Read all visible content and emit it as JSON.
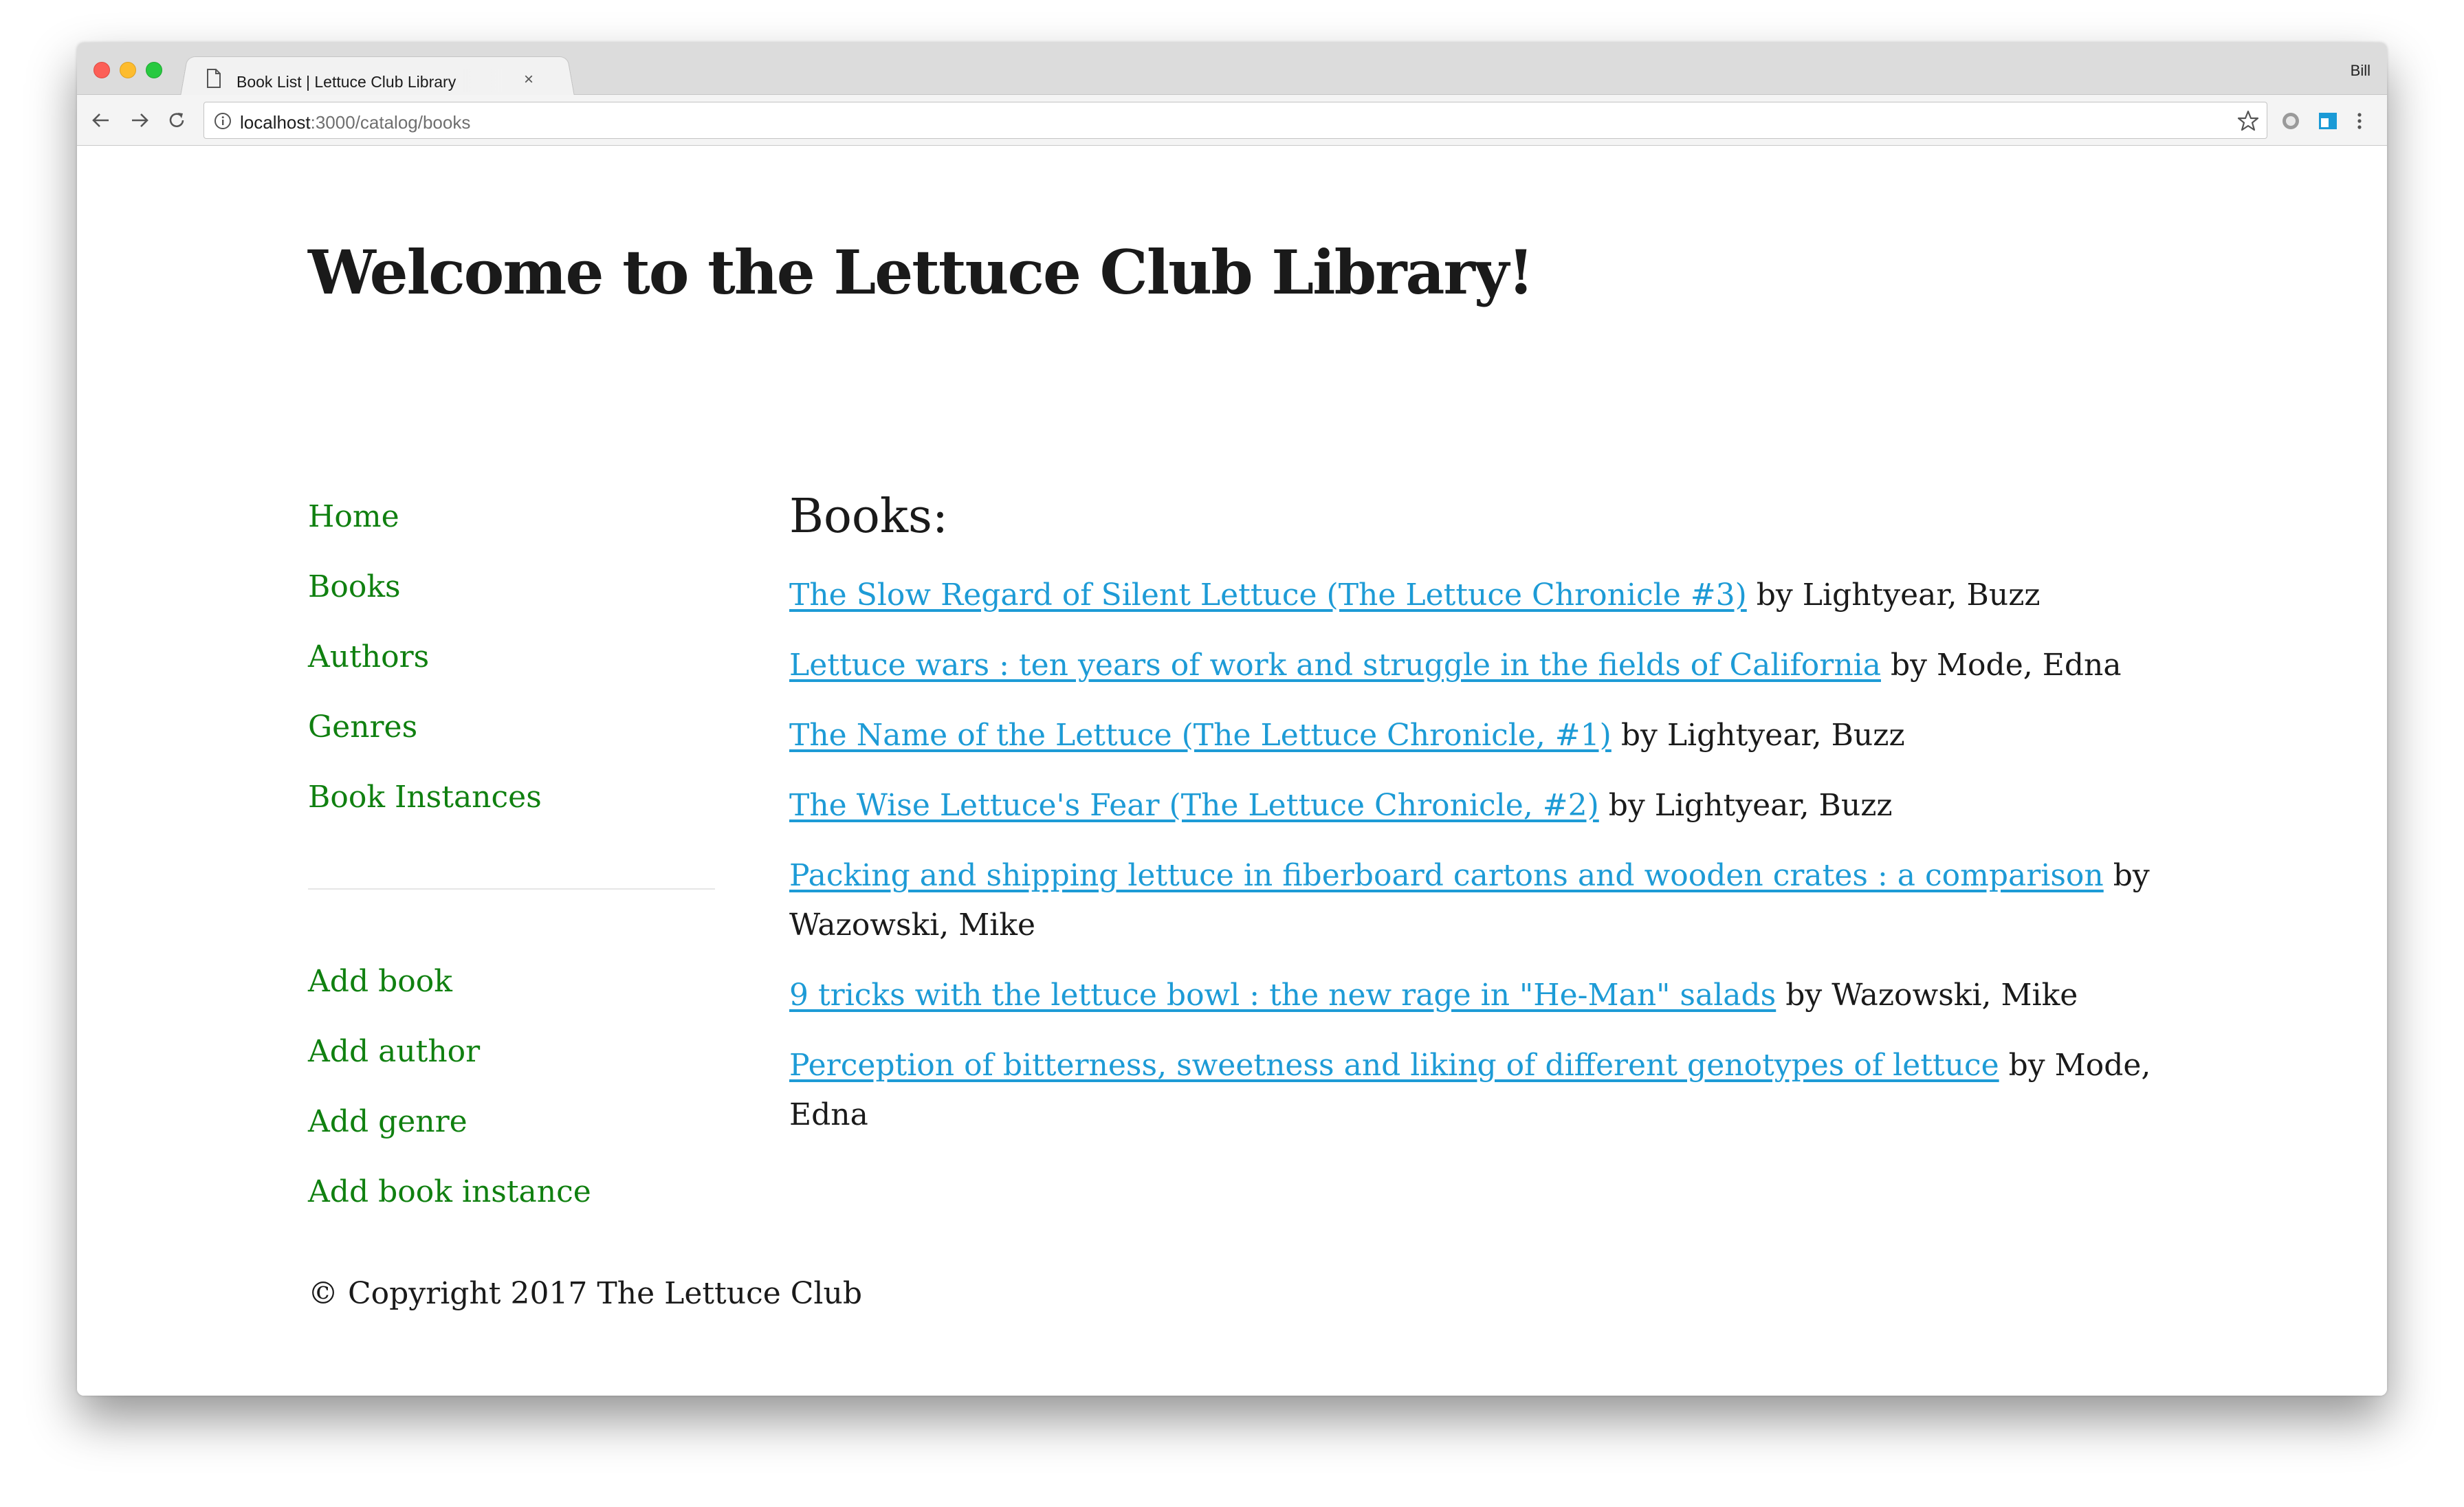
{
  "browser": {
    "tab_title": "Book List | Lettuce Club Library",
    "tab_close": "×",
    "profile_name": "Bill",
    "url_host": "localhost",
    "url_path": ":3000/catalog/books"
  },
  "header": {
    "welcome_prefix": "Welcome to the ",
    "welcome_brand": "Lettuce Club Library",
    "welcome_suffix": "!"
  },
  "sidebar": {
    "nav": [
      "Home",
      "Books",
      "Authors",
      "Genres",
      "Book Instances"
    ],
    "actions": [
      "Add book",
      "Add author",
      "Add genre",
      "Add book instance"
    ]
  },
  "main": {
    "heading": "Books:",
    "books": [
      {
        "title": "The Slow Regard of Silent Lettuce (The Lettuce Chronicle #3)",
        "author": " by Lightyear, Buzz"
      },
      {
        "title": "Lettuce wars : ten years of work and struggle in the fields of California",
        "author": " by Mode, Edna"
      },
      {
        "title": "The Name of the Lettuce (The Lettuce Chronicle, #1)",
        "author": " by Lightyear, Buzz"
      },
      {
        "title": "The Wise Lettuce's Fear (The Lettuce Chronicle, #2)",
        "author": " by Lightyear, Buzz"
      },
      {
        "title": "Packing and shipping lettuce in fiberboard cartons and wooden crates : a comparison",
        "author": " by Wazowski, Mike"
      },
      {
        "title": "9 tricks with the lettuce bowl : the new rage in \"He-Man\" salads",
        "author": " by Wazowski, Mike"
      },
      {
        "title": "Perception of bitterness, sweetness and liking of different genotypes of lettuce",
        "author": " by Mode, Edna"
      }
    ]
  },
  "footer": {
    "copyright": "© Copyright 2017 The Lettuce Club"
  },
  "icons": {
    "page": "page-icon",
    "back": "back-arrow-icon",
    "forward": "forward-arrow-icon",
    "reload": "reload-icon",
    "info": "info-icon",
    "star": "bookmark-star-icon",
    "extension1": "circle-extension-icon",
    "extension2": "window-extension-icon",
    "menu": "kebab-menu-icon"
  },
  "colors": {
    "nav_link": "#108010",
    "book_link": "#1d9bd6",
    "text": "#1a1a1a"
  }
}
